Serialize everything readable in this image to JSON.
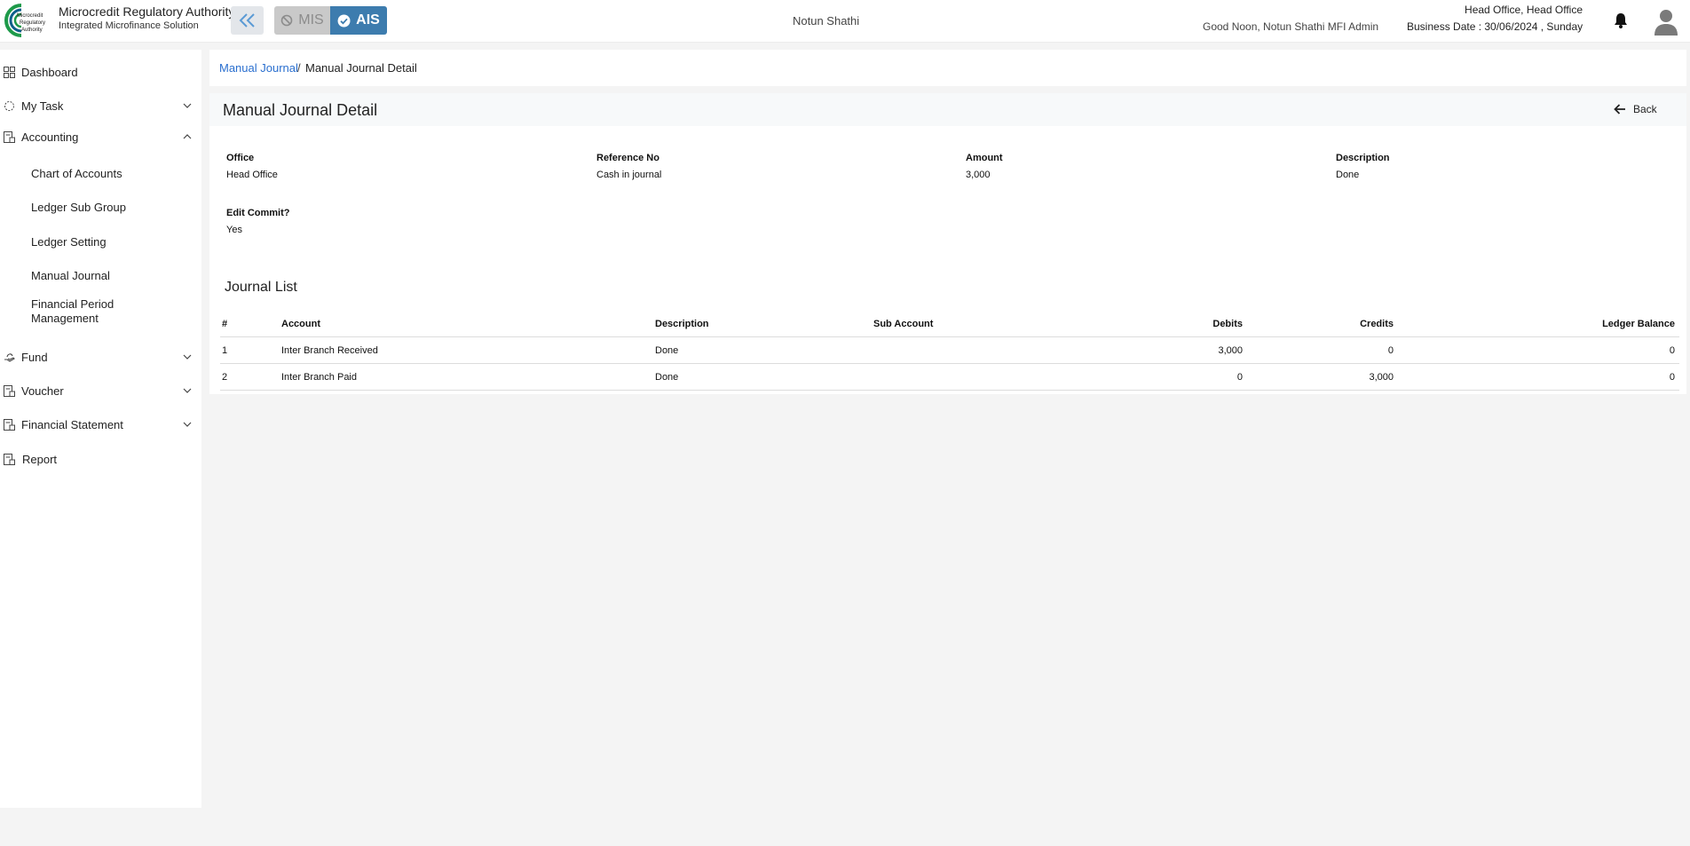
{
  "header": {
    "brand_title": "Microcredit Regulatory Authority",
    "brand_subtitle": "Integrated Microfinance Solution",
    "logo_text": [
      "Microcredit",
      "Regulatory",
      "Authority"
    ],
    "mis_label": "MIS",
    "ais_label": "AIS",
    "org_name": "Notun Shathi",
    "greeting": "Good Noon, Notun Shathi MFI Admin",
    "office": "Head Office, Head Office",
    "business_date": "Business Date : 30/06/2024 , Sunday"
  },
  "sidebar": {
    "items": [
      {
        "label": "Dashboard",
        "icon": "grid-icon"
      },
      {
        "label": "My Task",
        "icon": "spinner-icon"
      },
      {
        "label": "Accounting",
        "icon": "ledger-icon"
      },
      {
        "label": "Fund",
        "icon": "hand-money-icon"
      },
      {
        "label": "Voucher",
        "icon": "ledger-icon"
      },
      {
        "label": "Financial Statement",
        "icon": "ledger-icon"
      },
      {
        "label": "Report",
        "icon": "report-icon"
      }
    ],
    "accounting_sub": [
      "Chart of Accounts",
      "Ledger Sub Group",
      "Ledger Setting",
      "Manual Journal",
      "Financial Period Management"
    ]
  },
  "breadcrumb": {
    "parent": "Manual Journal",
    "separator": "/",
    "current": "Manual Journal Detail"
  },
  "detail": {
    "title": "Manual Journal Detail",
    "back_label": "Back",
    "fields": [
      {
        "label": "Office",
        "value": "Head Office"
      },
      {
        "label": "Reference No",
        "value": "Cash in journal"
      },
      {
        "label": "Amount",
        "value": "3,000"
      },
      {
        "label": "Description",
        "value": "Done"
      },
      {
        "label": "Edit Commit?",
        "value": "Yes"
      }
    ]
  },
  "journal": {
    "title": "Journal List",
    "columns": [
      "#",
      "Account",
      "Description",
      "Sub Account",
      "Debits",
      "Credits",
      "Ledger Balance"
    ],
    "rows": [
      [
        "1",
        "Inter Branch Received",
        "Done",
        "",
        "3,000",
        "0",
        "0"
      ],
      [
        "2",
        "Inter Branch Paid",
        "Done",
        "",
        "0",
        "3,000",
        "0"
      ]
    ]
  },
  "colors": {
    "accent": "#3d7cae",
    "link": "#2a6fcf",
    "logo_green": "#1e9a4a"
  }
}
